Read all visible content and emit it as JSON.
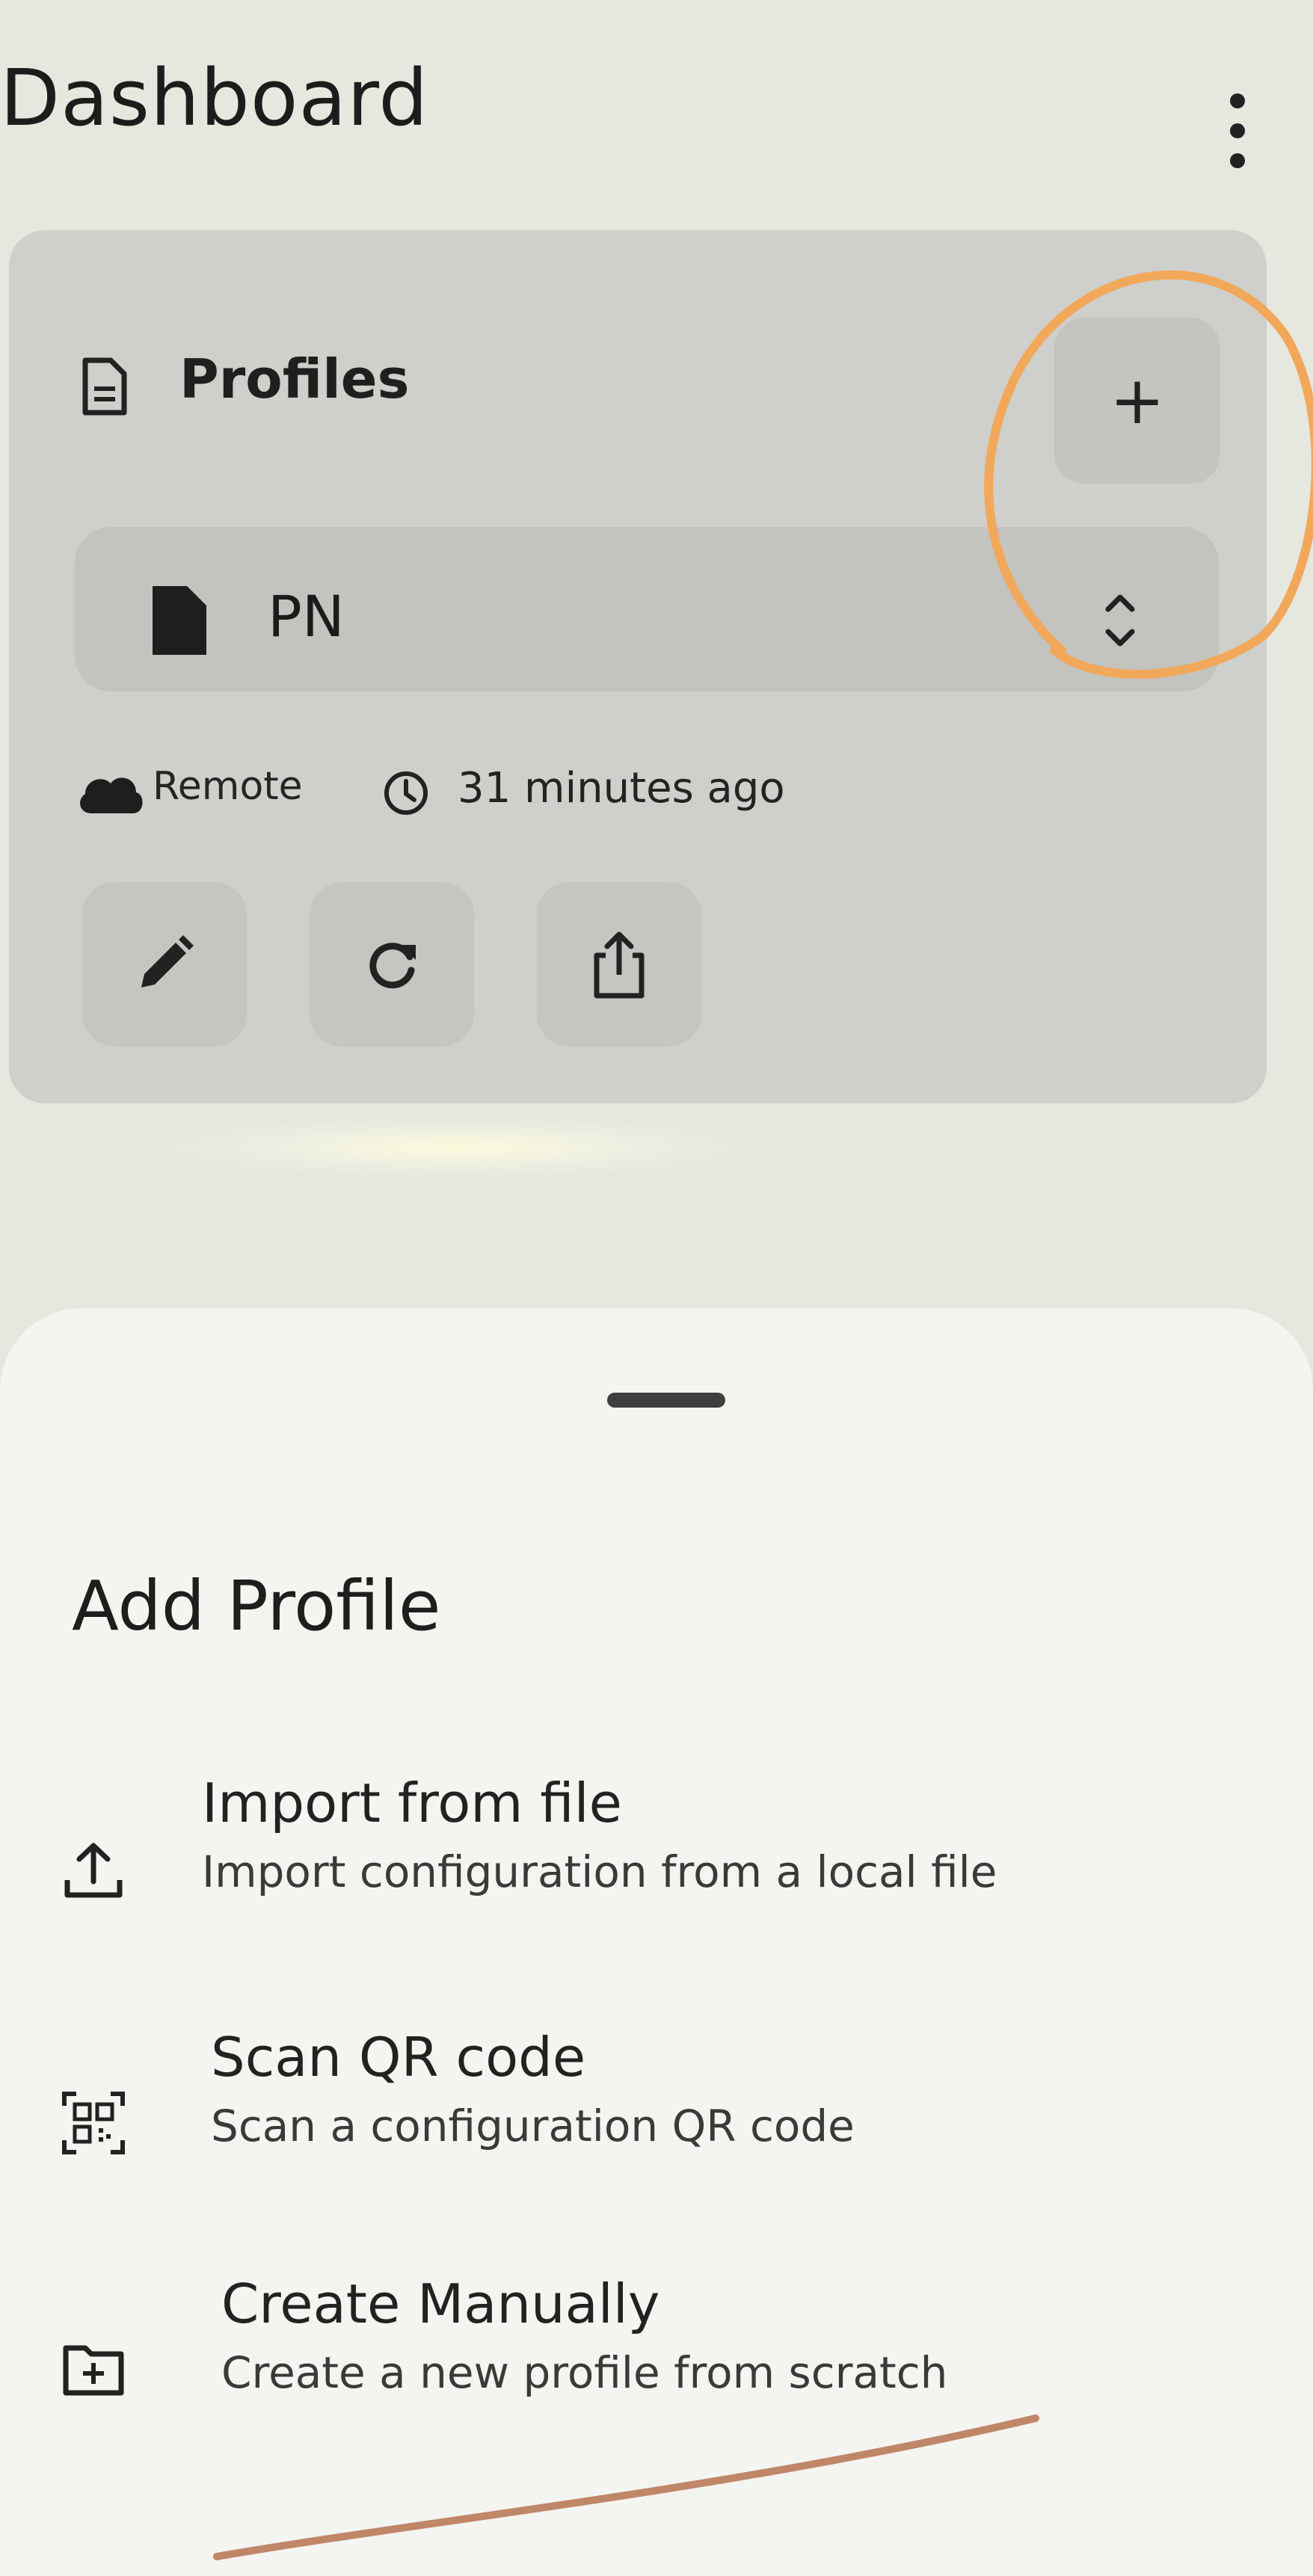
{
  "header": {
    "title": "Dashboard",
    "menu_icon": "more-vert-icon"
  },
  "profiles_card": {
    "title": "Profiles",
    "title_icon": "document-icon",
    "add_icon": "plus-icon",
    "add_label": "+",
    "selected_profile": {
      "name": "PN",
      "icon": "file-icon",
      "expand_icon": "unfold-icon"
    },
    "meta": {
      "source_label": "Remote",
      "source_icon": "cloud-icon",
      "updated_label": "31 minutes ago",
      "updated_icon": "clock-icon"
    },
    "actions": [
      {
        "icon": "edit-icon"
      },
      {
        "icon": "refresh-icon"
      },
      {
        "icon": "share-icon"
      }
    ]
  },
  "sheet": {
    "title": "Add Profile",
    "options": [
      {
        "title": "Import from file",
        "subtitle": "Import configuration from a local file",
        "icon": "upload-icon"
      },
      {
        "title": "Scan QR code",
        "subtitle": "Scan a configuration QR code",
        "icon": "qr-scan-icon"
      },
      {
        "title": "Create Manually",
        "subtitle": "Create a new profile from scratch",
        "icon": "folder-add-icon"
      }
    ]
  },
  "colors": {
    "background": "#e6e7de",
    "card": "#cfcfcb",
    "sheet": "#f4f4f1",
    "annotation_orange": "#f2a85a",
    "annotation_brown": "#c08668"
  }
}
